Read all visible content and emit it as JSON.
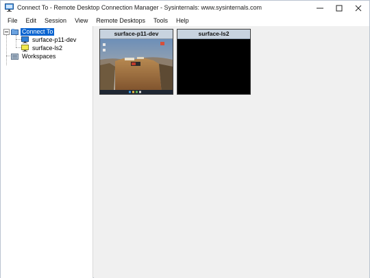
{
  "window": {
    "title": "Connect To - Remote Desktop Connection Manager - Sysinternals: www.sysinternals.com"
  },
  "menu": [
    "File",
    "Edit",
    "Session",
    "View",
    "Remote Desktops",
    "Tools",
    "Help"
  ],
  "tree": {
    "root": "Connect To",
    "children": [
      "surface-p11-dev",
      "surface-ls2"
    ],
    "workspaces": "Workspaces"
  },
  "thumbnails": [
    {
      "name": "surface-p11-dev",
      "state": "connected-desktop"
    },
    {
      "name": "surface-ls2",
      "state": "black-screen"
    }
  ],
  "colors": {
    "selection": "#0a64d0",
    "thumb_header": "#c8d3df",
    "background": "#f0f0f0"
  }
}
